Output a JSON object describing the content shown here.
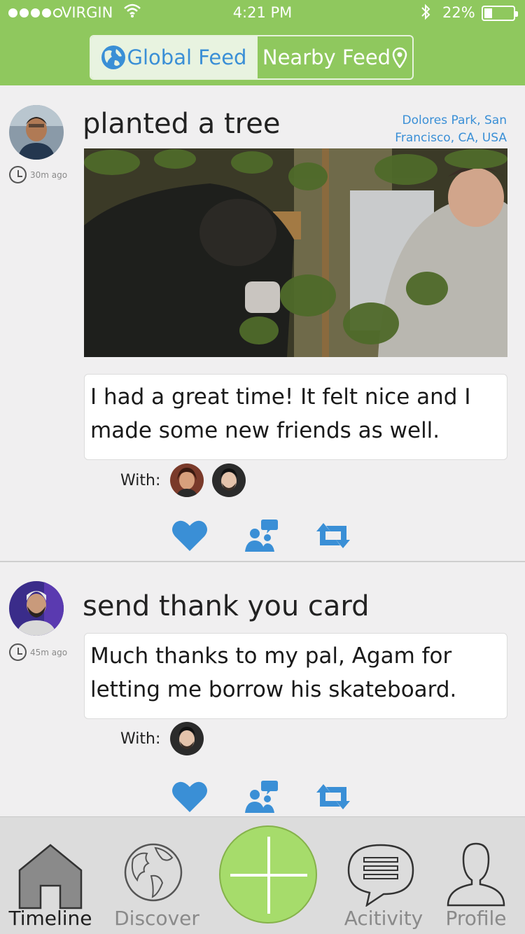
{
  "status": {
    "carrier": "VIRGIN",
    "time": "4:21 PM",
    "battery": "22%",
    "battery_level": 0.22
  },
  "header": {
    "tabs": [
      {
        "label": "Global Feed",
        "icon": "globe-icon",
        "active": true
      },
      {
        "label": "Nearby Feed",
        "icon": "location-pin-icon",
        "active": false
      }
    ]
  },
  "posts": [
    {
      "activity": "planted a tree",
      "time_ago": "30m ago",
      "location": "Dolores Park, San Francisco, CA, USA",
      "photo": "photo-tree-planting",
      "comment": "I had a great time! It felt nice and I made some new friends as well.",
      "with_label": "With:",
      "with": [
        "friend-avatar-1",
        "friend-avatar-2"
      ]
    },
    {
      "activity": "send thank you card",
      "time_ago": "45m ago",
      "comment": "Much thanks to my pal, Agam for letting me borrow his skateboard.",
      "with_label": "With:",
      "with": [
        "friend-avatar-2"
      ]
    }
  ],
  "actions": [
    "heart-icon",
    "comment-people-icon",
    "retweet-icon"
  ],
  "colors": {
    "brand_green": "#8fc85e",
    "accent_blue": "#3a8fd6",
    "add_button": "#a6dc6b"
  },
  "tabbar": {
    "items": [
      {
        "label": "Timeline",
        "icon": "home-icon",
        "active": true
      },
      {
        "label": "Discover",
        "icon": "globe-icon",
        "active": false
      },
      {
        "label": "",
        "icon": "plus-icon",
        "active": false
      },
      {
        "label": "Acitivity",
        "icon": "chat-bubble-icon",
        "active": false
      },
      {
        "label": "Profile",
        "icon": "person-icon",
        "active": false
      }
    ]
  }
}
